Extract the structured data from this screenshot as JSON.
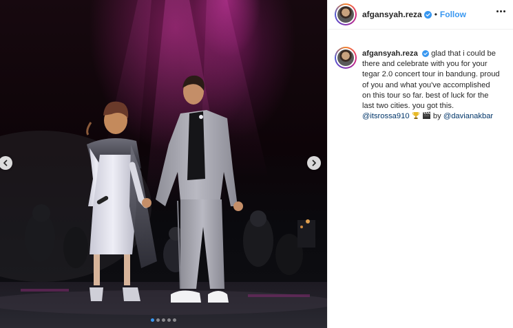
{
  "post": {
    "username": "afgansyah.reza",
    "follow_separator": "•",
    "follow_label": "Follow",
    "verified_icon": "verified-badge-icon",
    "more_icon": "more-options-icon"
  },
  "caption": {
    "username": "afgansyah.reza",
    "text": "glad that i could be there and celebrate with you for your tegar 2.0 concert tour in bandung. proud of you and what you've accomplished on this tour so far. best of luck for the last two cities. you got this.",
    "mention_1": "@itsrossa910",
    "emoji_1": "trophy-emoji",
    "emoji_2": "clapper-board-emoji",
    "by_label": "by",
    "mention_2": "@davianakbar"
  },
  "carousel": {
    "dot_count": 5,
    "active_dot": 1,
    "prev_icon": "chevron-left-icon",
    "next_icon": "chevron-right-icon"
  },
  "colors": {
    "link": "#3897f0",
    "mention": "#003569",
    "text": "#262626",
    "border": "#efefef"
  }
}
